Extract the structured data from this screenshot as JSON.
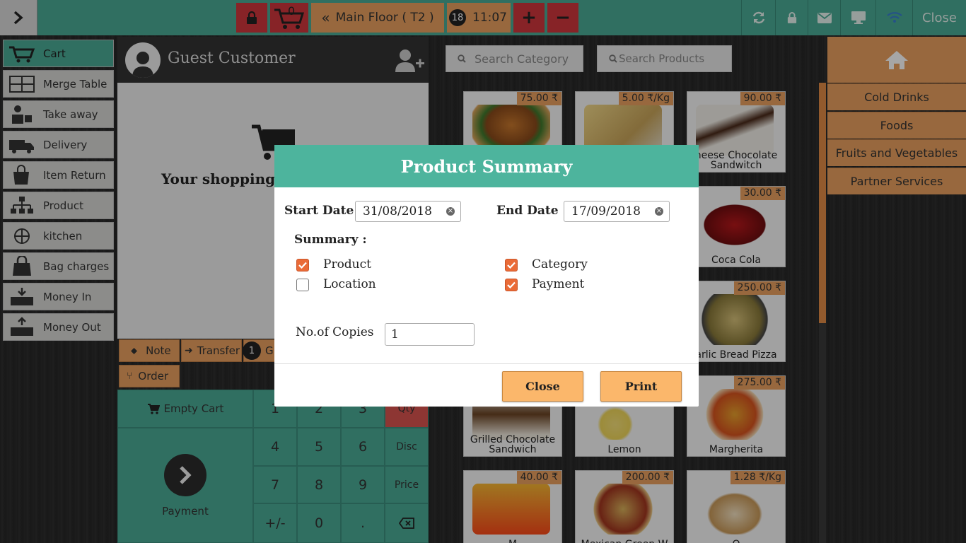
{
  "topbar": {
    "cart_count": "0",
    "floor_label": "Main Floor ( T2 )",
    "floor_badge": "18",
    "time": "11:07",
    "plus": "+",
    "minus": "−",
    "close_label": "Close"
  },
  "nav": {
    "items": [
      {
        "label": "Cart",
        "icon": "cart-icon"
      },
      {
        "label": "Merge Table",
        "icon": "merge-table-icon"
      },
      {
        "label": "Take away",
        "icon": "take-away-icon"
      },
      {
        "label": "Delivery",
        "icon": "delivery-truck-icon"
      },
      {
        "label": "Item Return",
        "icon": "item-return-icon"
      },
      {
        "label": "Product",
        "icon": "product-tree-icon"
      },
      {
        "label": "kitchen",
        "icon": "kitchen-icon"
      },
      {
        "label": "Bag charges",
        "icon": "bag-icon"
      },
      {
        "label": "Money In",
        "icon": "money-in-icon"
      },
      {
        "label": "Money Out",
        "icon": "money-out-icon"
      }
    ]
  },
  "cart": {
    "customer": "Guest Customer",
    "empty_text": "Your shopping",
    "note_label": "Note",
    "transfer_label": "Transfer",
    "guest_badge": "1",
    "guest_label": "G",
    "order_label": "Order",
    "empty_cart_label": "Empty Cart",
    "payment_label": "Payment"
  },
  "keypad": {
    "row1": [
      "1",
      "2",
      "3",
      "Qty"
    ],
    "row2": [
      "4",
      "5",
      "6",
      "Disc"
    ],
    "row3": [
      "7",
      "8",
      "9",
      "Price"
    ],
    "row4": [
      "+/-",
      "0",
      "."
    ]
  },
  "search": {
    "category_placeholder": "Search Category",
    "product_placeholder": "Search Products"
  },
  "categories": [
    "Cold Drinks",
    "Foods",
    "Fruits and Vegetables",
    "Partner Services"
  ],
  "products": [
    {
      "name": "",
      "price": "75.00 ₹"
    },
    {
      "name": "",
      "price": "5.00 ₹/Kg"
    },
    {
      "name": "heese Chocolate Sandwitch",
      "price": "90.00 ₹"
    },
    {
      "name": "Coca Cola",
      "price": "30.00 ₹"
    },
    {
      "name": "arlic Bread Pizza",
      "price": "250.00 ₹"
    },
    {
      "name": "Grilled Chocolate Sandwich",
      "price": ""
    },
    {
      "name": "Lemon",
      "price": ""
    },
    {
      "name": "Margherita",
      "price": "275.00 ₹"
    },
    {
      "name": "M",
      "price": "40.00 ₹"
    },
    {
      "name": "Mexican Green W",
      "price": "200.00 ₹"
    },
    {
      "name": "O",
      "price": "1.28 ₹/Kg"
    }
  ],
  "modal": {
    "title": "Product Summary",
    "start_label": "Start Date",
    "start_value": "31/08/2018",
    "end_label": "End Date",
    "end_value": "17/09/2018",
    "summary_label": "Summary :",
    "options": {
      "product": {
        "label": "Product",
        "checked": true
      },
      "category": {
        "label": "Category",
        "checked": true
      },
      "location": {
        "label": "Location",
        "checked": false
      },
      "payment": {
        "label": "Payment",
        "checked": true
      }
    },
    "copies_label": "No.of Copies",
    "copies_value": "1",
    "close_label": "Close",
    "print_label": "Print"
  }
}
